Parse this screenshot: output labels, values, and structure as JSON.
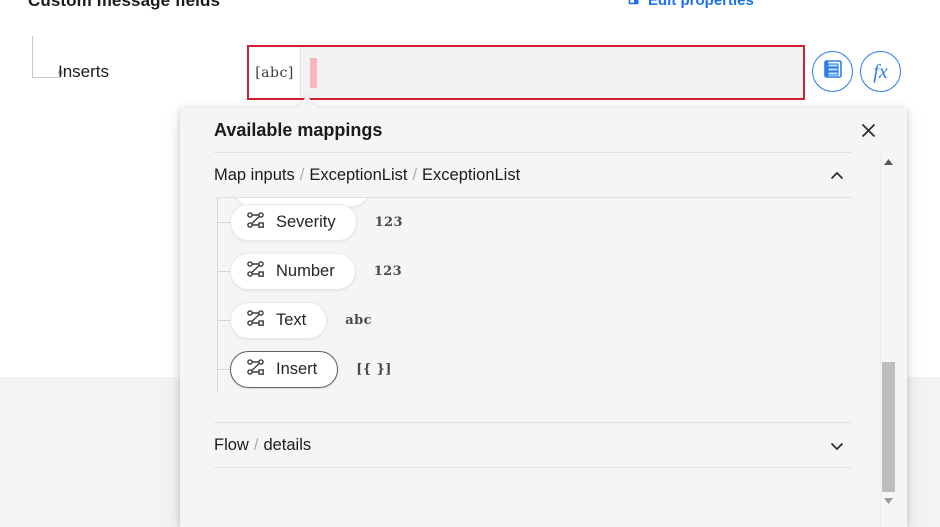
{
  "page": {
    "title": "Custom message fields",
    "edit_link_label": "Edit properties",
    "edit_link_icon": "open-in-new-icon",
    "field_row_label": "Inserts"
  },
  "input": {
    "type_prefix": "[abc]",
    "value": "",
    "caret_visible": true,
    "border_color": "#d32030",
    "background": "#f2f2f2"
  },
  "toolbar": {
    "list_button_name": "dynamic-content-list-icon",
    "fx_button_label": "fx",
    "accent_color": "#2b7de9"
  },
  "panel": {
    "title": "Available mappings",
    "close_label": "✕",
    "sections": [
      {
        "crumbs": [
          "Map inputs",
          "ExceptionList",
          "ExceptionList"
        ],
        "separator": "/",
        "expanded": true,
        "chevron": "chevron-up",
        "items": [
          {
            "label": "Severity",
            "type_badge": "123",
            "selected": false
          },
          {
            "label": "Number",
            "type_badge": "123",
            "selected": false
          },
          {
            "label": "Text",
            "type_badge": "abc",
            "selected": false
          },
          {
            "label": "Insert",
            "type_badge": "[{ }]",
            "selected": true
          }
        ]
      },
      {
        "crumbs": [
          "Flow",
          "details"
        ],
        "separator": "/",
        "expanded": false,
        "chevron": "chevron-down",
        "items": []
      }
    ],
    "scrollbar": {
      "up_arrow": "▲",
      "down_arrow": "▼",
      "thumb_position_percent": 62
    }
  }
}
